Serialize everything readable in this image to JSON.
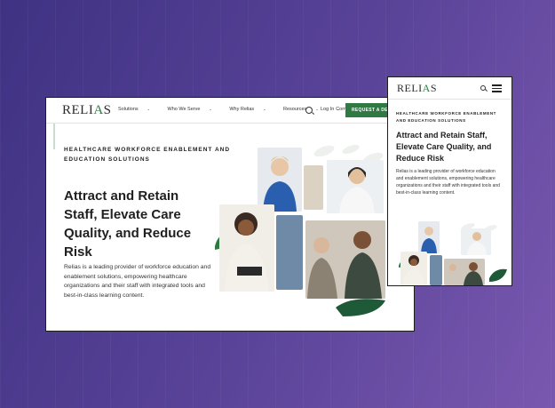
{
  "brand": {
    "logo_text_left": "RELI",
    "logo_text_accent": "A",
    "logo_text_right": "S",
    "accent": "#2f7a43"
  },
  "desktop": {
    "nav": {
      "items": [
        {
          "label": "Solutions"
        },
        {
          "label": "Who We Serve"
        },
        {
          "label": "Why Relias"
        },
        {
          "label": "Resources"
        },
        {
          "label": "Company"
        }
      ],
      "login": "Log In",
      "cta": "REQUEST A DEM"
    },
    "eyebrow": "HEALTHCARE WORKFORCE ENABLEMENT AND EDUCATION SOLUTIONS",
    "headline": "Attract and Retain Staff, Elevate Care Quality, and Reduce Risk",
    "body": "Relias is a leading provider of workforce education and enablement solutions, empowering healthcare organizations and their staff with integrated tools and best-in-class learning content."
  },
  "mobile": {
    "eyebrow": "HEALTHCARE WORKFORCE ENABLEMENT AND EDUCATION SOLUTIONS",
    "headline": "Attract and Retain Staff, Elevate Care Quality, and Reduce Risk",
    "body": "Relias is a leading provider of workforce education and enablement solutions, empowering healthcare organizations and their staff with integrated tools and best-in-class learning content."
  }
}
